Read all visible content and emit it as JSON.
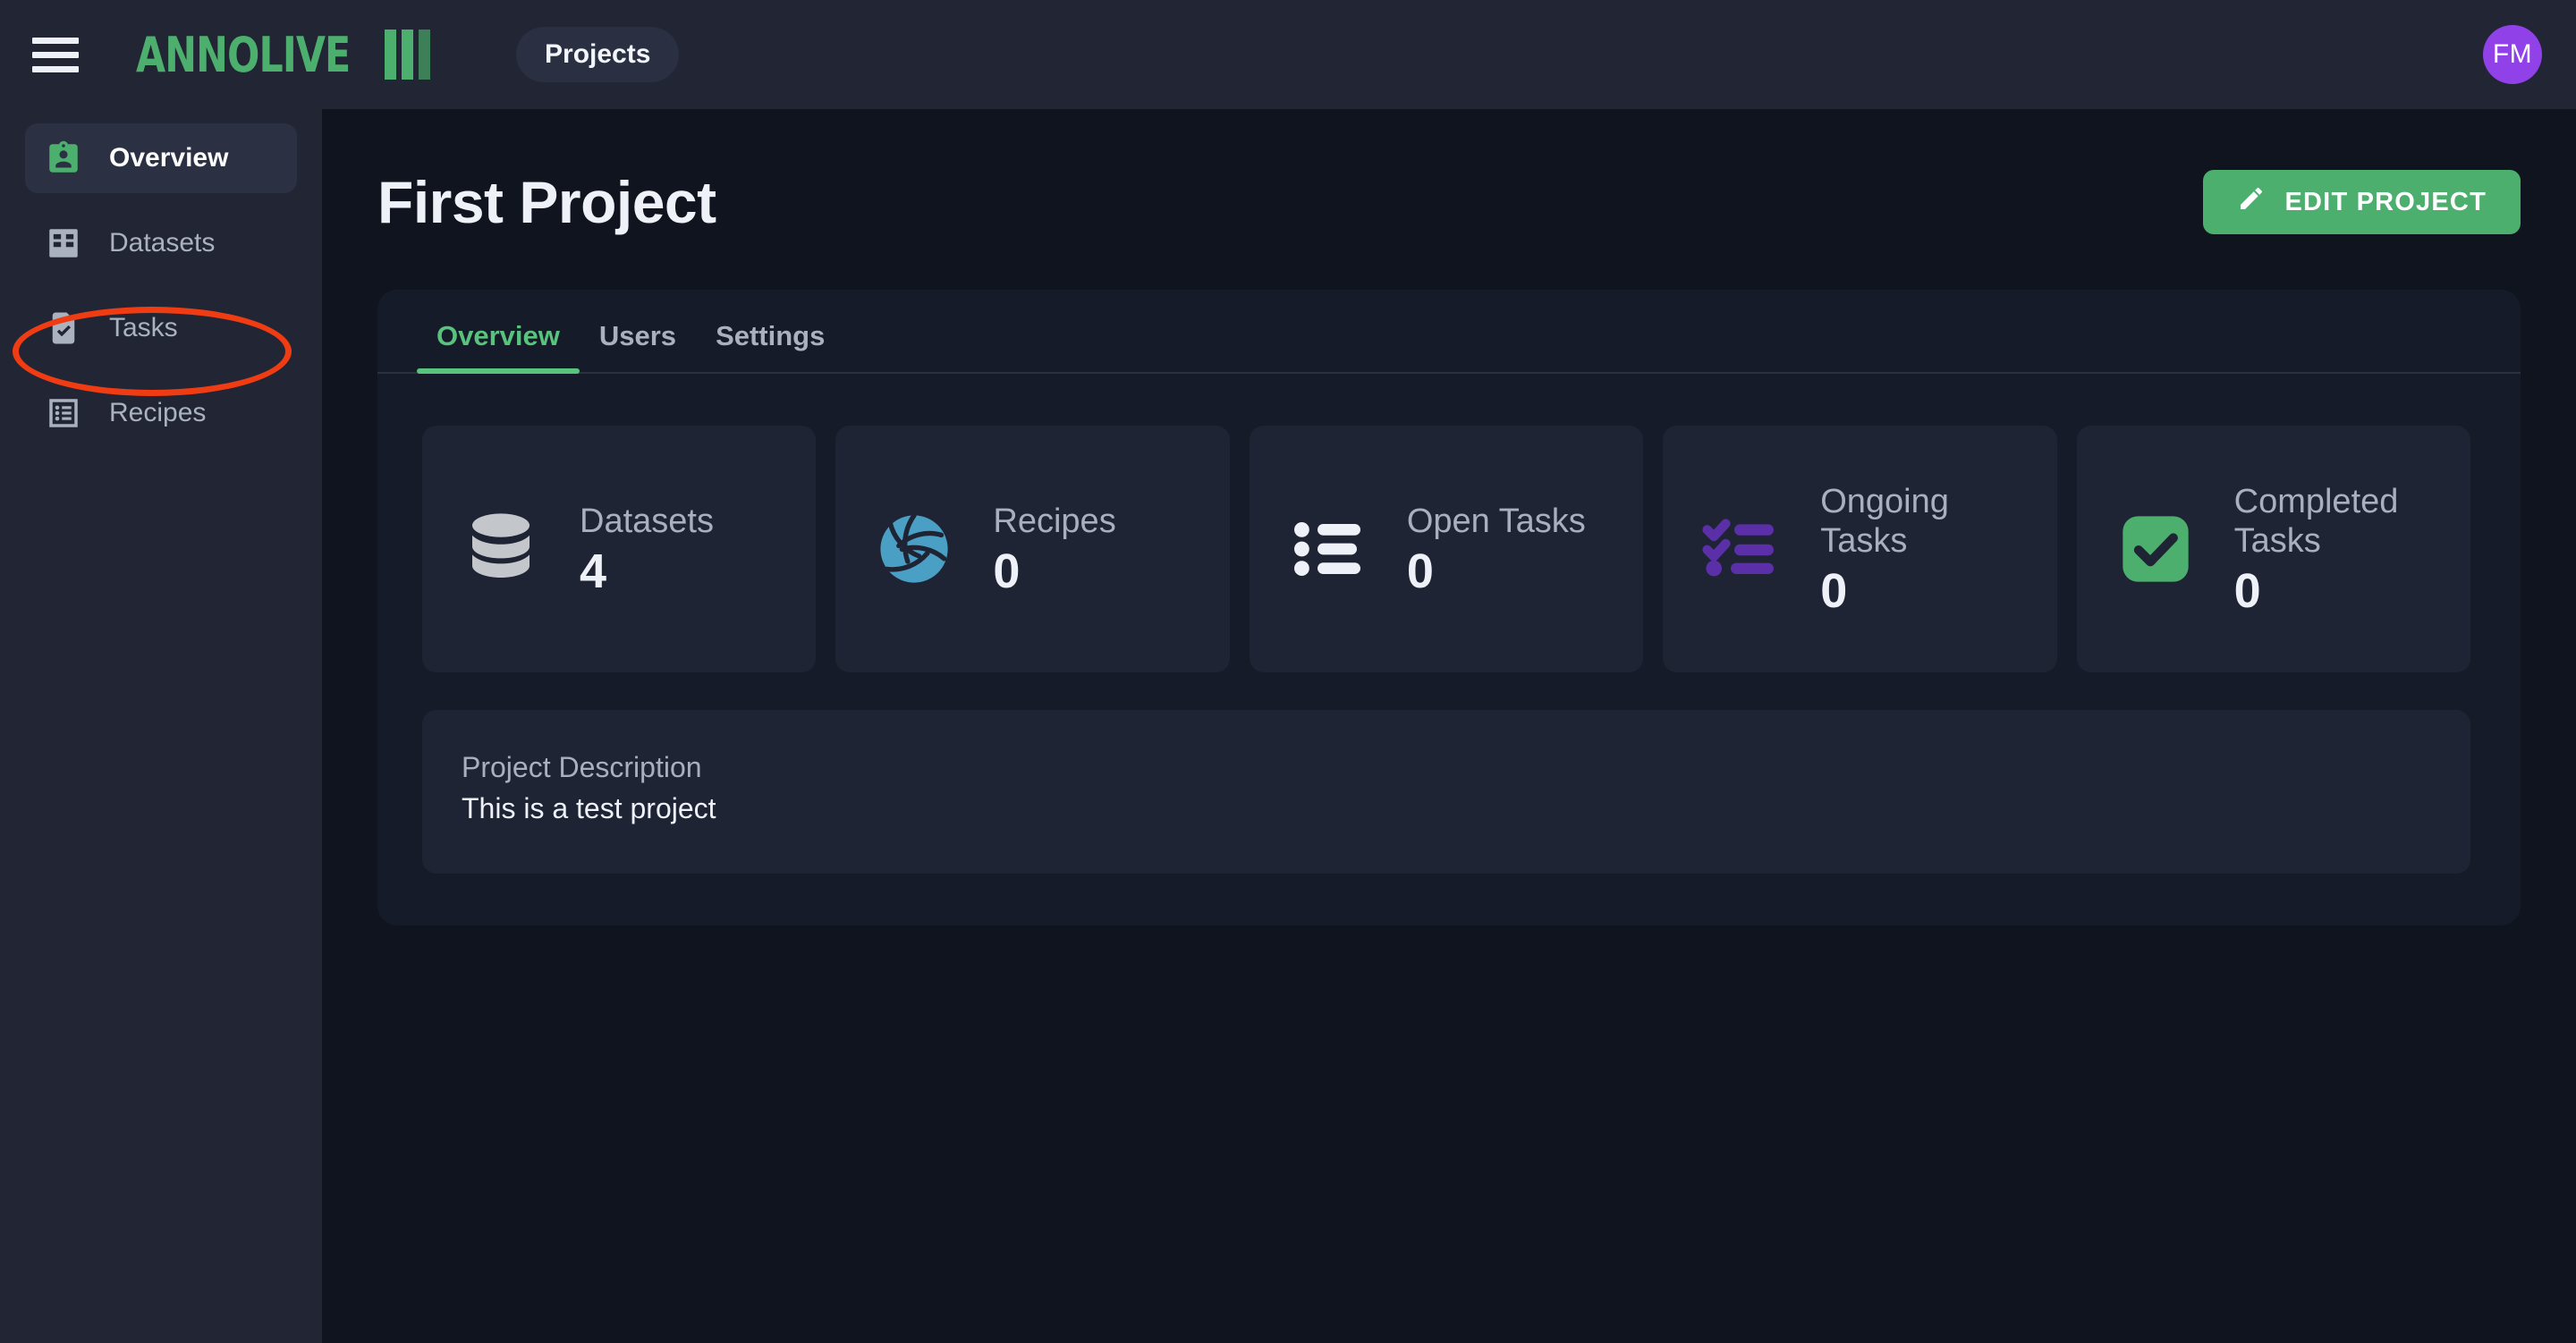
{
  "topbar": {
    "menu_icon": "hamburger-menu-icon",
    "logo_text": "ANNOLIVE",
    "projects_chip": "Projects",
    "avatar_initials": "FM",
    "avatar_color": "#9141e8"
  },
  "sidebar": {
    "items": [
      {
        "label": "Overview",
        "icon": "badge-person-icon",
        "active": true
      },
      {
        "label": "Datasets",
        "icon": "grid-table-icon",
        "active": false
      },
      {
        "label": "Tasks",
        "icon": "document-check-icon",
        "active": false
      },
      {
        "label": "Recipes",
        "icon": "list-box-icon",
        "active": false
      }
    ]
  },
  "annotation": {
    "shape": "ellipse",
    "color": "#f03c12",
    "targets": "sidebar-item-datasets"
  },
  "page": {
    "title": "First Project",
    "edit_button_label": "EDIT PROJECT",
    "edit_button_icon": "pencil-icon",
    "edit_button_color": "#4caf6e"
  },
  "tabs": [
    {
      "label": "Overview",
      "active": true
    },
    {
      "label": "Users",
      "active": false
    },
    {
      "label": "Settings",
      "active": false
    }
  ],
  "stats": [
    {
      "label": "Datasets",
      "value": "4",
      "icon": "database-icon",
      "icon_color": "#c3c6cb"
    },
    {
      "label": "Recipes",
      "value": "0",
      "icon": "volleyball-icon",
      "icon_color": "#4a9fc4"
    },
    {
      "label": "Open Tasks",
      "value": "0",
      "icon": "bulleted-list-icon",
      "icon_color": "#eef1f8"
    },
    {
      "label": "Ongoing Tasks",
      "value": "0",
      "icon": "checklist-icon",
      "icon_color": "#5b2fa8"
    },
    {
      "label": "Completed Tasks",
      "value": "0",
      "icon": "check-square-icon",
      "icon_color": "#4caf6e"
    }
  ],
  "description": {
    "label": "Project Description",
    "value": "This is a test project"
  },
  "theme": {
    "page_bg": "#10141f",
    "sidebar_bg": "#212534",
    "card_bg": "#161b29",
    "tile_bg": "#1f2434",
    "accent_green": "#4caf6e"
  }
}
